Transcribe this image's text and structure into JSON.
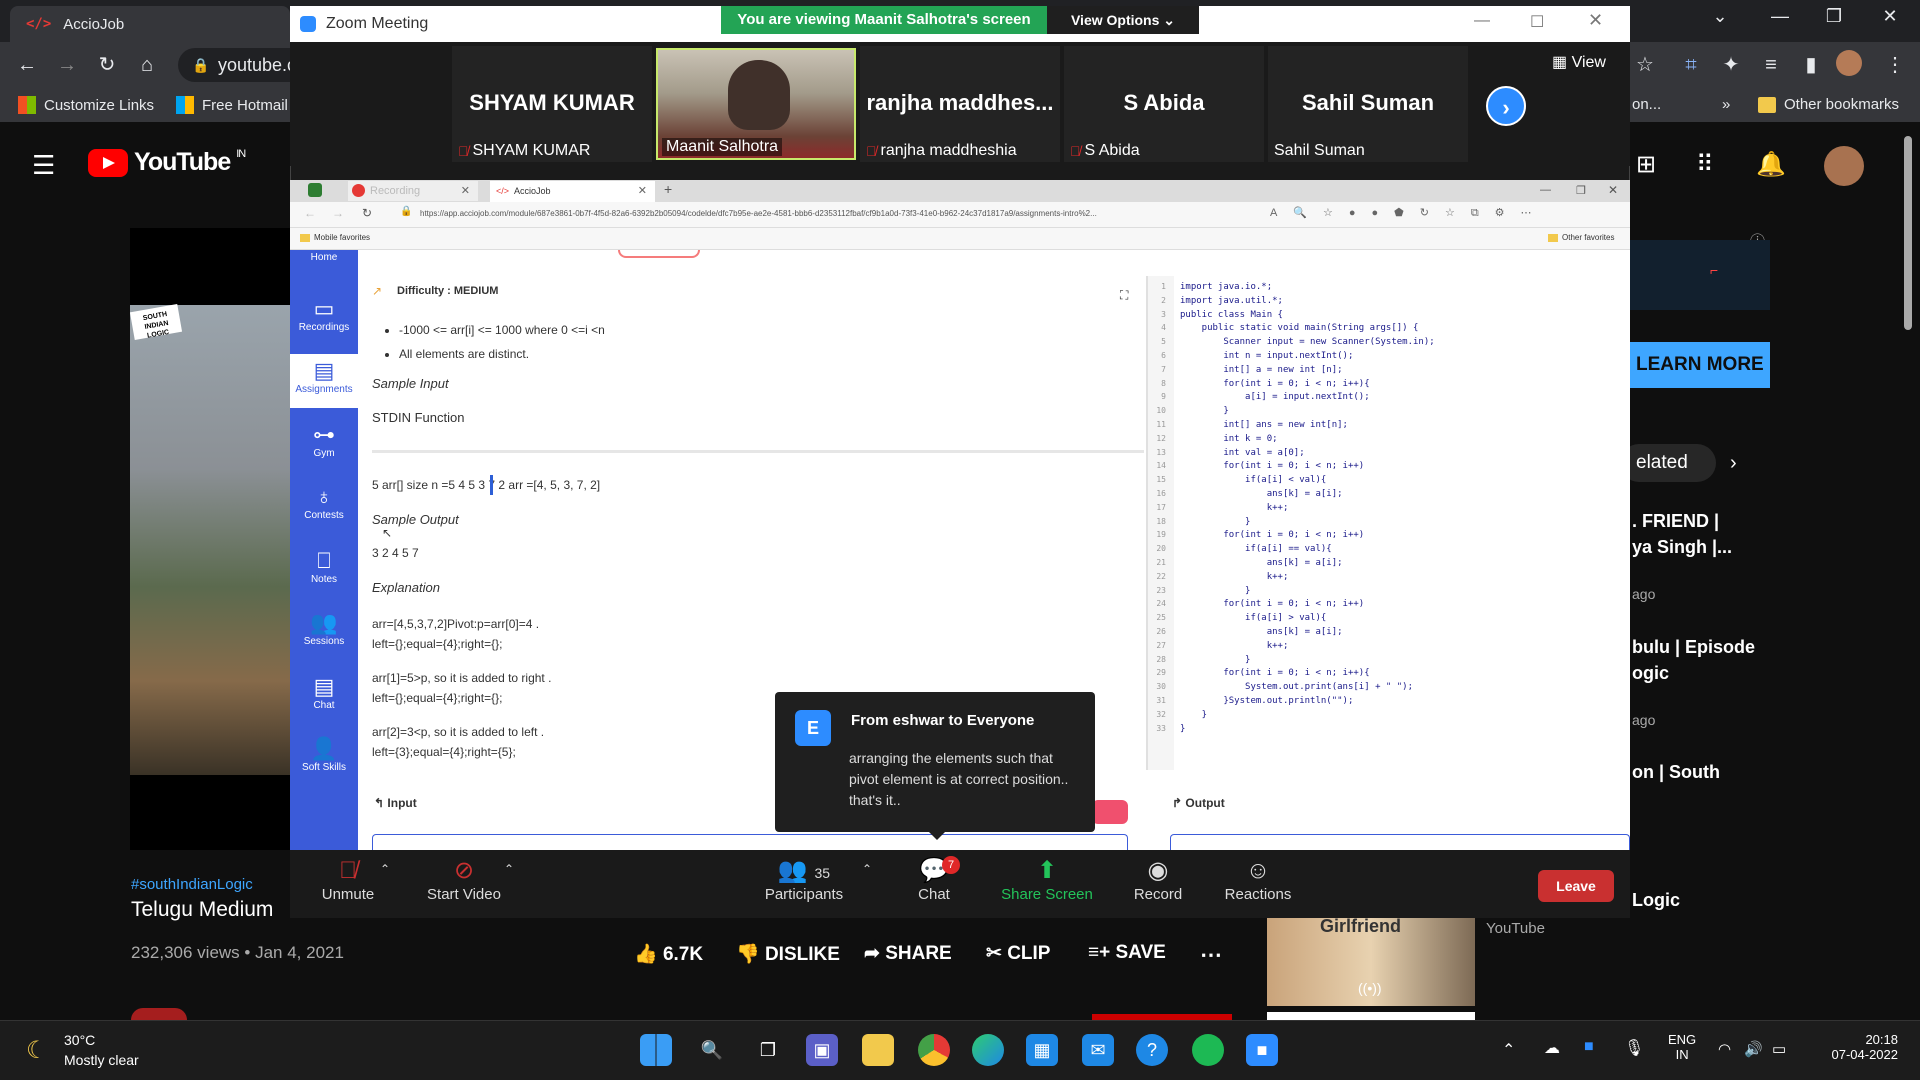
{
  "chrome": {
    "tab_title": "AccioJob",
    "omnibox_text": "youtube.c",
    "bookmarks": [
      "Customize Links",
      "Free Hotmail",
      "Other bookmarks"
    ],
    "omnibox_right": "on..."
  },
  "youtube": {
    "logo_text": "YouTube",
    "country": "IN",
    "hashtag": "#southIndianLogic",
    "video_title": "Telugu Medium",
    "views": "232,306 views • Jan 4, 2021",
    "likes": "6.7K",
    "dislike": "DISLIKE",
    "share": "SHARE",
    "clip": "CLIP",
    "save": "SAVE",
    "learn_more": "LEARN MORE",
    "related_chip": "elated",
    "related": [
      {
        "line1": ". FRIEND |",
        "line2": "ya Singh |..."
      },
      {
        "line1": "ago",
        "line2": ""
      },
      {
        "line1": "bulu | Episode",
        "line2": "ogic"
      },
      {
        "line1": "ago",
        "line2": ""
      },
      {
        "line1": "on | South",
        "line2": ""
      },
      {
        "line1": "Logic",
        "line2": ""
      }
    ],
    "thumb_channel": "YouTube",
    "thumb_title": "Girlfriend"
  },
  "zoom": {
    "title": "Zoom Meeting",
    "viewing_banner": "You are viewing Maanit Salhotra's screen",
    "view_options": "View Options",
    "view_button": "View",
    "participants_tiles": [
      {
        "big": "SHYAM KUMAR",
        "label": "SHYAM KUMAR",
        "muted": true
      },
      {
        "big": "",
        "label": "Maanit Salhotra",
        "muted": false
      },
      {
        "big": "ranjha  maddhes...",
        "label": "ranjha maddheshia",
        "muted": true
      },
      {
        "big": "S Abida",
        "label": "S Abida",
        "muted": true
      },
      {
        "big": "Sahil Suman",
        "label": "Sahil Suman",
        "muted": false
      }
    ],
    "controls": {
      "unmute": "Unmute",
      "start_video": "Start Video",
      "participants": "Participants",
      "participants_count": "35",
      "chat": "Chat",
      "chat_badge": "7",
      "share_screen": "Share Screen",
      "record": "Record",
      "reactions": "Reactions",
      "leave": "Leave"
    },
    "chat_popup": {
      "avatar": "E",
      "from": "From eshwar to Everyone",
      "message": "arranging the elements such that pivot element is at correct position.. that's it.."
    }
  },
  "shared": {
    "tab1": "Recording",
    "tab2": "AccioJob",
    "url": "https://app.acciojob.com/module/687e3861-0b7f-4f5d-82a6-6392b2b05094/codelde/dfc7b95e-ae2e-4581-bbb6-d2353112fbaf/cf9b1a0d-73f3-41e0-b962-24c37d1817a9/assignments-intro%2...",
    "mobile_fav": "Mobile favorites",
    "other_fav": "Other favorites",
    "sidebar": [
      "Home",
      "Recordings",
      "Assignments",
      "Gym",
      "Contests",
      "Notes",
      "Sessions",
      "Chat",
      "Soft Skills"
    ],
    "difficulty": "Difficulty : MEDIUM",
    "bullets": [
      "-1000 <= arr[i] <= 1000 where 0 <=i <n",
      "All elements are distinct."
    ],
    "sample_input_h": "Sample Input",
    "stdin": "STDIN Function",
    "input_line": "5 arr[] size n =5 4 5 3 7 2 arr =[4, 5, 3, 7, 2]",
    "sample_output_h": "Sample Output",
    "output_line": "3 2 4 5 7",
    "explanation_h": "Explanation",
    "exp": [
      [
        "arr=[4,5,3,7,2]Pivot:p=arr[0]=4 .",
        "left={};equal={4};right={};"
      ],
      [
        "arr[1]=5>p, so it is added to right .",
        "left={};equal={4};right={};"
      ],
      [
        "arr[2]=3<p, so it is added to left .",
        "left={3};equal={4};right={5};"
      ]
    ],
    "input_label": "Input",
    "output_label": "Output",
    "code": [
      "import java.io.*;",
      "import java.util.*;",
      "public class Main {",
      "    public static void main(String args[]) {",
      "        Scanner input = new Scanner(System.in);",
      "        int n = input.nextInt();",
      "        int[] a = new int [n];",
      "        for(int i = 0; i < n; i++){",
      "            a[i] = input.nextInt();",
      "        }",
      "        int[] ans = new int[n];",
      "        int k = 0;",
      "        int val = a[0];",
      "        for(int i = 0; i < n; i++)",
      "            if(a[i] < val){",
      "                ans[k] = a[i];",
      "                k++;",
      "            }",
      "        for(int i = 0; i < n; i++)",
      "            if(a[i] == val){",
      "                ans[k] = a[i];",
      "                k++;",
      "            }",
      "        for(int i = 0; i < n; i++)",
      "            if(a[i] > val){",
      "                ans[k] = a[i];",
      "                k++;",
      "            }",
      "        for(int i = 0; i < n; i++){",
      "            System.out.print(ans[i] + \" \");",
      "        }System.out.println(\"\");",
      "    }",
      "}"
    ]
  },
  "taskbar": {
    "temp": "30°C",
    "weather": "Mostly clear",
    "lang1": "ENG",
    "lang2": "IN",
    "time": "20:18",
    "date": "07-04-2022"
  },
  "colors": {
    "zoom_green": "#23a455",
    "accio_blue": "#3b5bd9",
    "leave_red": "#c93030",
    "yt_red": "#ff0000"
  }
}
